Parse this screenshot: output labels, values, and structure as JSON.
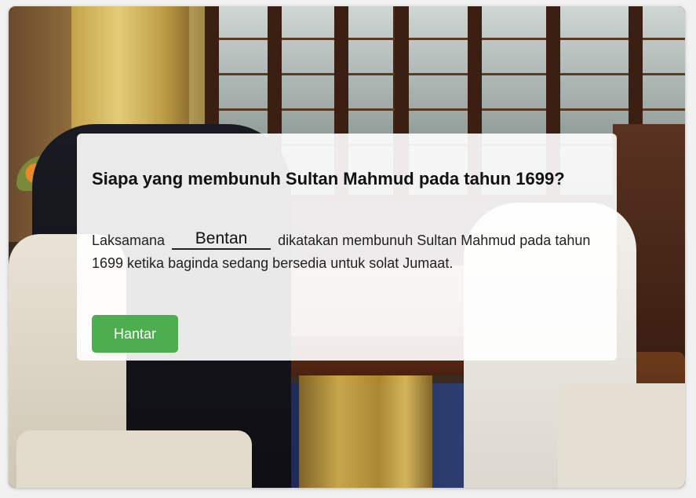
{
  "quiz": {
    "question": "Siapa yang membunuh Sultan Mahmud pada tahun 1699?",
    "sentence_before": "Laksamana",
    "answer_value": "Bentan",
    "sentence_after": "dikatakan membunuh Sultan Mahmud pada tahun 1699 ketika baginda sedang bersedia untuk solat Jumaat.",
    "submit_label": "Hantar"
  },
  "colors": {
    "submit_button": "#4cae4f",
    "card_background": "rgba(255,255,255,0.91)"
  }
}
